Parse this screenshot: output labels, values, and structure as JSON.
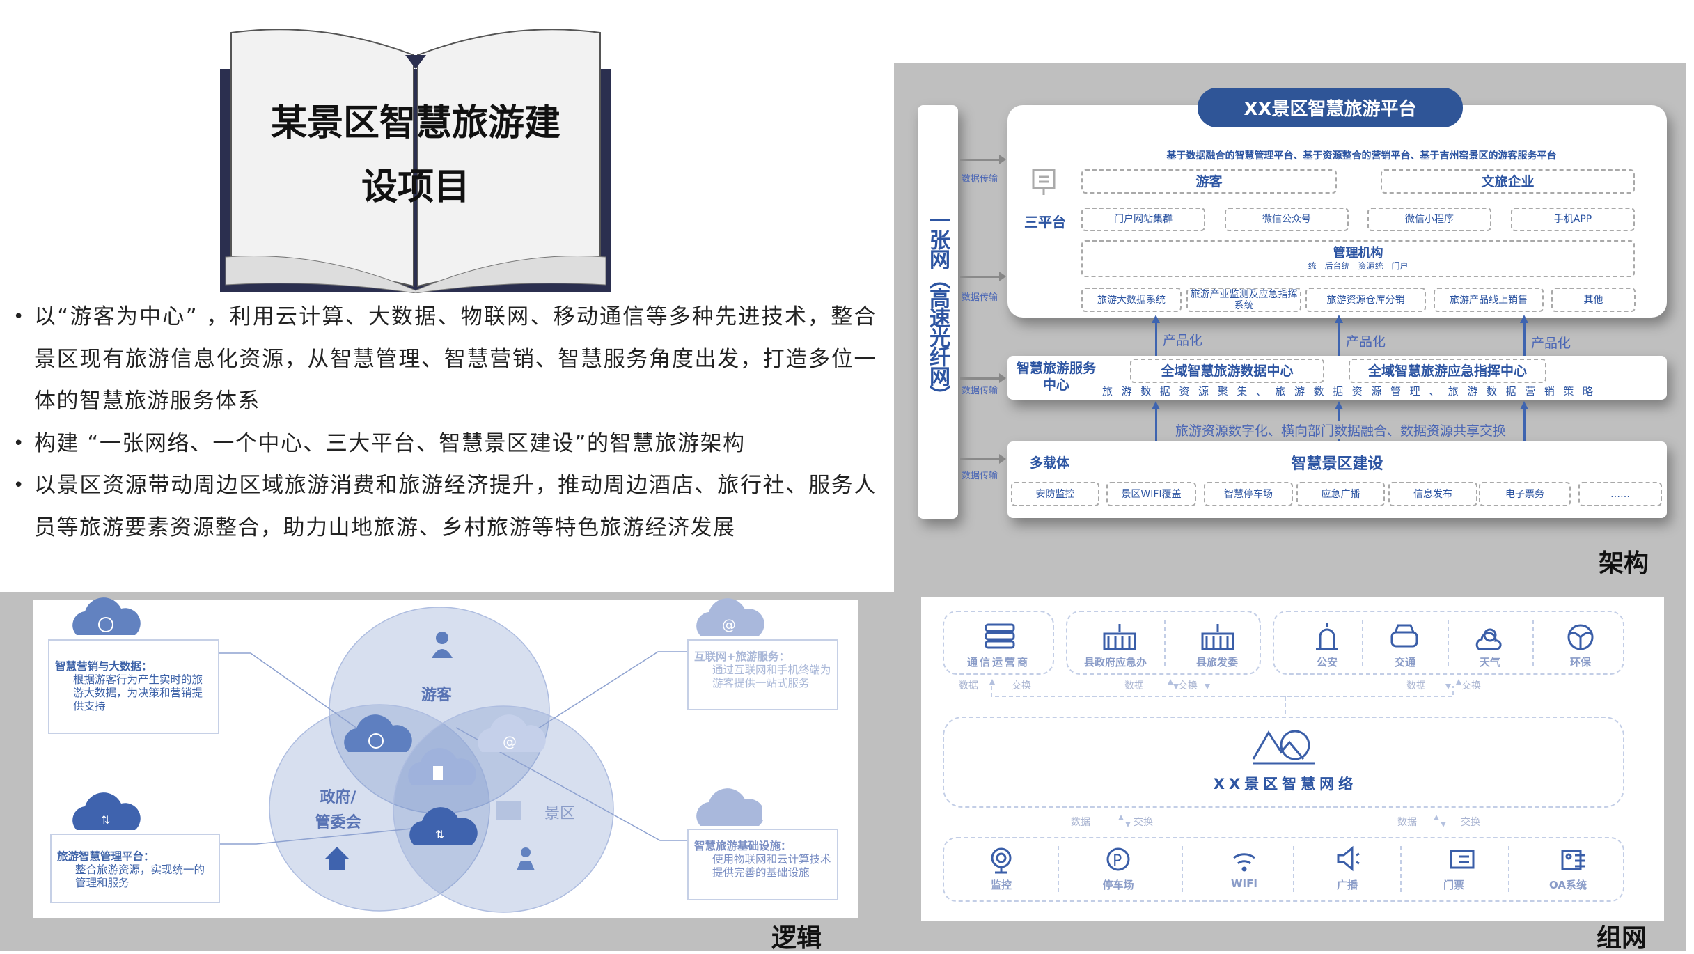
{
  "colors": {
    "primary_blue": "#2d55a2",
    "title_pill": "#2f5597",
    "panel_gray": "#bfbfbf",
    "venn_blue": "#b9c7e3"
  },
  "cover": {
    "title_line1": "某景区智慧旅游建",
    "title_line2": "设项目"
  },
  "bullets": [
    "以“游客为中心” ，利用云计算、大数据、物联网、移动通信等多种先进技术，整合景区现有旅游信息化资源，从智慧管理、智慧营销、智慧服务角度出发，打造多位一体的智慧旅游服务体系",
    "构建 “一张网络、一个中心、三大平台、智慧景区建设”的智慧旅游架构",
    "以景区资源带动周边区域旅游消费和旅游经济提升，推动周边酒店、旅行社、服务人员等旅游要素资源整合，助力山地旅游、乡村旅游等特色旅游经济发展"
  ],
  "section_labels": {
    "architecture": "架构",
    "logic": "逻辑",
    "network": "组网"
  },
  "architecture": {
    "network_label": "一张网（高速光纤网）",
    "transfer_label": "数据传输",
    "platform": {
      "title": "XX景区智慧旅游平台",
      "subtitle": "基于数据融合的智慧管理平台、基于资源整合的营销平台、基于吉州窑景区的游客服务平台",
      "label": "三平台",
      "users": [
        "游客",
        "文旅企业"
      ],
      "channels": [
        "门户网站集群",
        "微信公众号",
        "微信小程序",
        "手机APP"
      ],
      "management": {
        "title": "管理机构",
        "sub": "统　后台统　资源统　门户"
      },
      "systems": [
        "旅游大数据系统",
        "旅游产业监测及应急指挥系统",
        "旅游资源仓库分销",
        "旅游产品线上销售",
        "其他"
      ]
    },
    "productize_label": "产品化",
    "service_center": {
      "title": "智慧旅游服务中心",
      "centers": [
        "全域智慧旅游数据中心",
        "全域智慧旅游应急指挥中心"
      ],
      "functions": "旅游数据资源聚集、旅游数据资源管理、旅游数据营销策略"
    },
    "exchange_label": "旅游资源数字化、横向部门数据融合、数据资源共享交换",
    "construction": {
      "carrier_label": "多载体",
      "title": "智慧景区建设",
      "items": [
        "安防监控",
        "景区WIFI覆盖",
        "智慧停车场",
        "应急广播",
        "信息发布",
        "电子票务",
        "……"
      ]
    }
  },
  "logic": {
    "circles": {
      "tourist": "游客",
      "government_line1": "政府/",
      "government_line2": "管委会",
      "scenic": "景区"
    },
    "boxes": [
      {
        "title": "智慧营销与大数据：",
        "body": "根据游客行为产生实时的旅游大数据，为决策和营销提供支持"
      },
      {
        "title": "旅游智慧管理平台：",
        "body": "整合旅游资源，实现统一的管理和服务"
      },
      {
        "title": "互联网+旅游服务：",
        "body": "通过互联网和手机终端为游客提供一站式服务"
      },
      {
        "title": "智慧旅游基础设施：",
        "body": "使用物联网和云计算技术提供完善的基础设施"
      }
    ]
  },
  "network": {
    "top_groups": [
      [
        "通信运营商"
      ],
      [
        "县政府应急办",
        "县旅发委"
      ],
      [
        "公安",
        "交通",
        "天气",
        "环保"
      ]
    ],
    "data_label": "数据",
    "exchange_label": "交换",
    "center_title": "XX景区智慧网络",
    "bottom_items": [
      "监控",
      "停车场",
      "WIFI",
      "广播",
      "门票",
      "OA系统"
    ]
  }
}
